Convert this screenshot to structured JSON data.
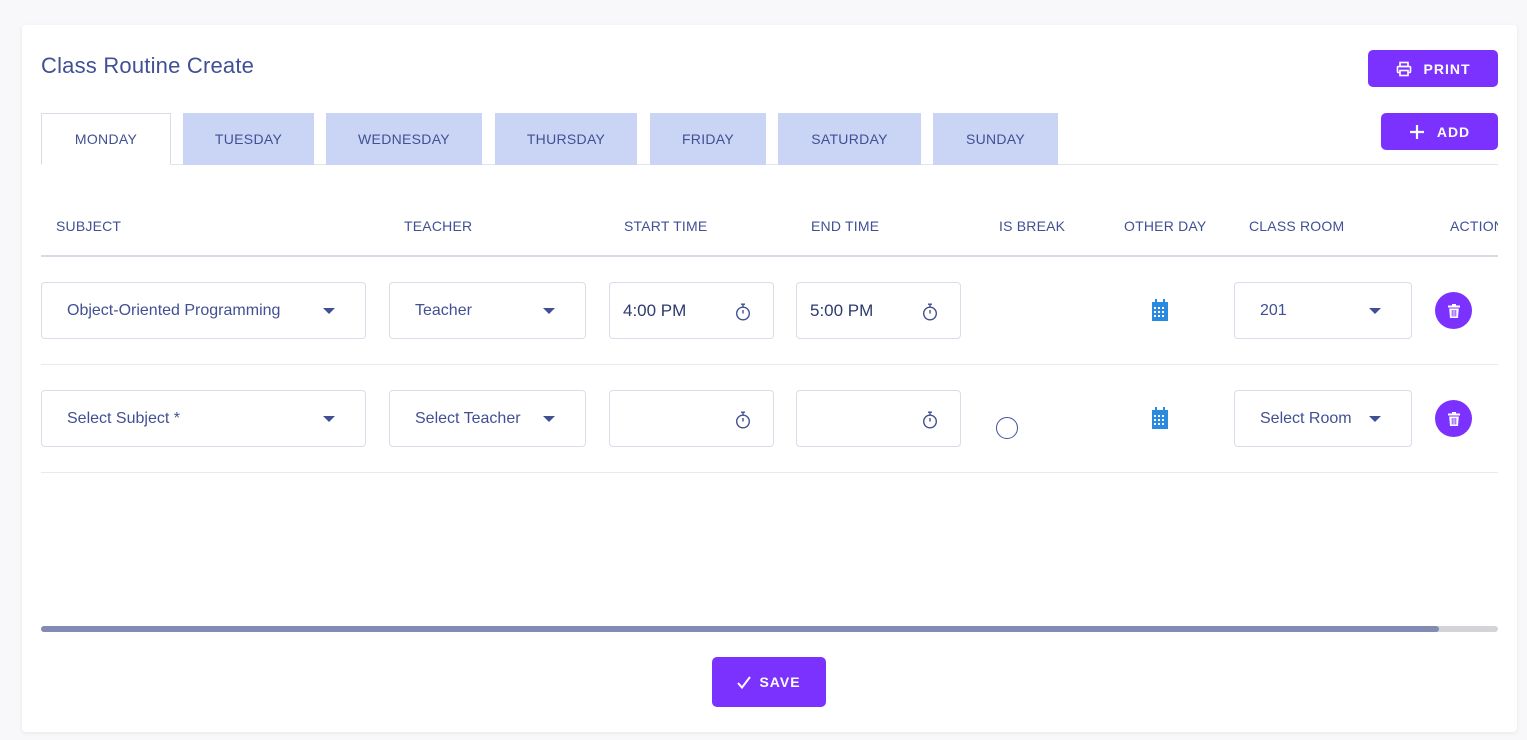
{
  "page": {
    "title": "Class Routine Create",
    "print_label": "PRINT",
    "add_label": "ADD",
    "save_label": "SAVE"
  },
  "tabs": [
    {
      "label": "MONDAY",
      "active": true
    },
    {
      "label": "TUESDAY",
      "active": false
    },
    {
      "label": "WEDNESDAY",
      "active": false
    },
    {
      "label": "THURSDAY",
      "active": false
    },
    {
      "label": "FRIDAY",
      "active": false
    },
    {
      "label": "SATURDAY",
      "active": false
    },
    {
      "label": "SUNDAY",
      "active": false
    }
  ],
  "table": {
    "headers": [
      "SUBJECT",
      "TEACHER",
      "START TIME",
      "END TIME",
      "IS BREAK",
      "OTHER DAY",
      "CLASS ROOM",
      "ACTION"
    ],
    "rows": [
      {
        "subject": "Object-Oriented Programming",
        "teacher": "Teacher",
        "start_time": "4:00 PM",
        "end_time": "5:00 PM",
        "is_break": false,
        "room": "201"
      },
      {
        "subject": "Select Subject *",
        "teacher": "Select Teacher",
        "start_time": "",
        "end_time": "",
        "is_break": false,
        "room": "Select Room"
      }
    ]
  },
  "colors": {
    "accent": "#7c32ff",
    "text": "#415094",
    "tab_inactive": "#cad5f5",
    "calendar_icon": "#2a8ae0",
    "scroll_thumb": "#828bb2"
  },
  "scroll": {
    "position_fraction": 0.96
  }
}
